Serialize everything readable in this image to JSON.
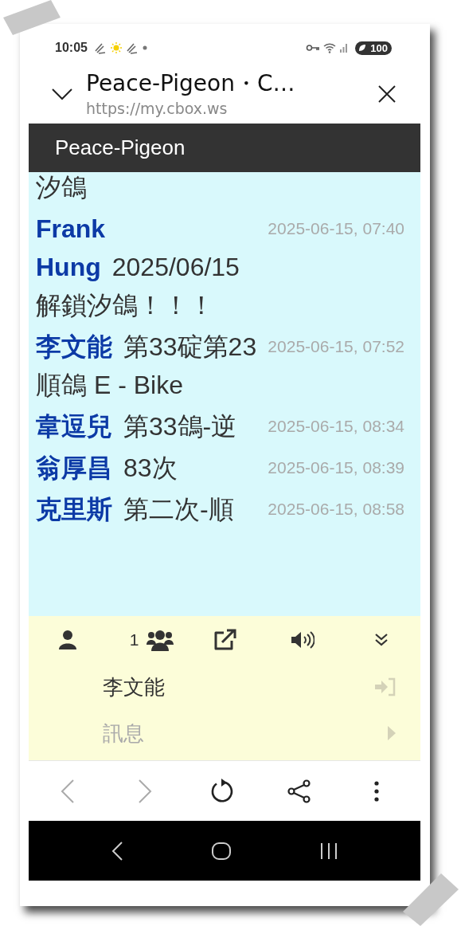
{
  "status_bar": {
    "time": "10:05",
    "battery": "100"
  },
  "browser": {
    "title": "Peace-Pigeon・C…",
    "url": "https://my.cbox.ws"
  },
  "chat": {
    "title": "Peace-Pigeon",
    "messages": [
      {
        "kind": "continuation",
        "text": "汐鴿"
      },
      {
        "kind": "message",
        "name": "Frank Hung",
        "time": "2025-06-15, 07:40",
        "text": "2025/06/15解鎖汐鴿！！！"
      },
      {
        "kind": "message",
        "name": "李文能",
        "time": "2025-06-15, 07:52",
        "text": "第33碇第23順鴿 E - Bike"
      },
      {
        "kind": "message",
        "name": "韋逗兒",
        "time": "2025-06-15, 08:34",
        "text": "第33鴿-逆"
      },
      {
        "kind": "message",
        "name": "翁厚昌",
        "time": "2025-06-15, 08:39",
        "text": "83次"
      },
      {
        "kind": "message",
        "name": "克里斯",
        "time": "2025-06-15, 08:58",
        "text": "第二次-順"
      }
    ]
  },
  "panel": {
    "online_count": "1",
    "name": "李文能",
    "message": {
      "placeholder": "訊息"
    }
  },
  "toolbar": [
    {
      "kind": "back",
      "disabled": true
    },
    {
      "kind": "forward",
      "disabled": true
    },
    {
      "kind": "reload",
      "disabled": false
    },
    {
      "kind": "share",
      "disabled": false
    },
    {
      "kind": "more",
      "disabled": false
    }
  ]
}
